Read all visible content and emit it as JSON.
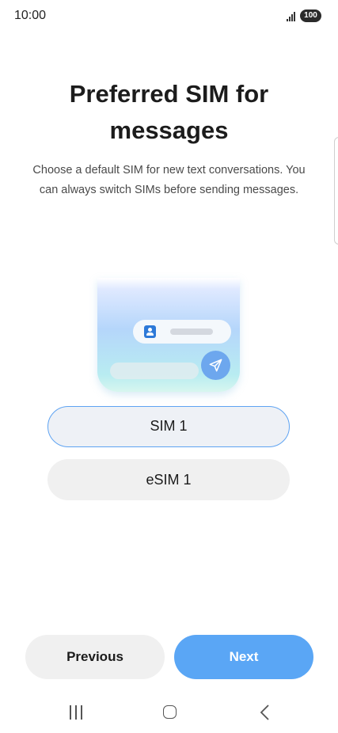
{
  "status_bar": {
    "time": "10:00",
    "battery": "100"
  },
  "page": {
    "title": "Preferred SIM for messages",
    "subtitle": "Choose a default SIM for new text conversations. You can always switch SIMs before sending messages."
  },
  "sim_options": [
    {
      "label": "SIM 1",
      "selected": true
    },
    {
      "label": "eSIM 1",
      "selected": false
    }
  ],
  "buttons": {
    "previous": "Previous",
    "next": "Next"
  },
  "colors": {
    "accent": "#5aa6f5",
    "selected_border": "#5ea3f2",
    "button_neutral": "#f0f0f0"
  }
}
